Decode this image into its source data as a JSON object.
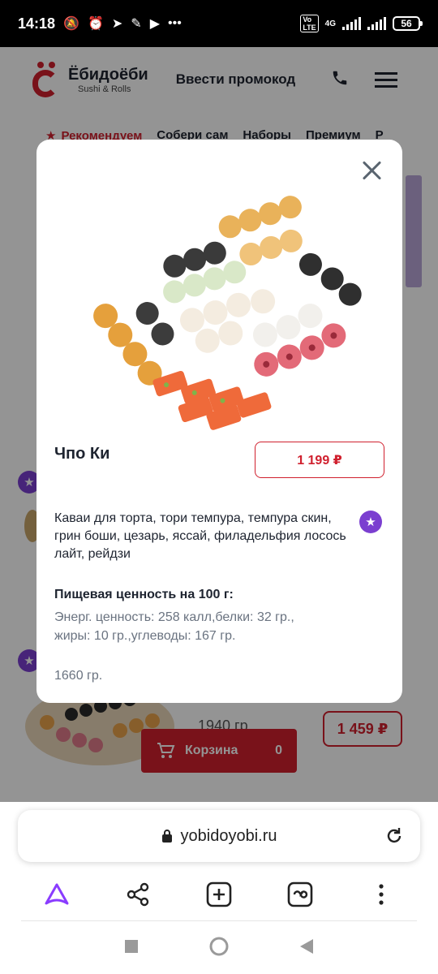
{
  "status_bar": {
    "time": "14:18",
    "network": "4G",
    "battery": "56"
  },
  "site": {
    "logo_title": "Ёбидоёби",
    "logo_sub": "Sushi & Rolls",
    "promo_label": "Ввести промокод",
    "categories": [
      "Рекомендуем",
      "Собери сам",
      "Наборы",
      "Премиум",
      "Р"
    ],
    "bg_weight": "1940 гр.",
    "bg_price": "1 459 ₽",
    "cart_label": "Корзина",
    "cart_count": "0"
  },
  "modal": {
    "product_name": "Чпо Ки",
    "price": "1 199 ₽",
    "description": "Каваи для торта, тори темпура, темпура скин, грин боши, цезарь, яссай, филадельфия лосось лайт, рейдзи",
    "nutrition_title": "Пищевая ценность на 100 г:",
    "nutrition_line1": "Энерг. ценность: 258 калл,белки: 32 гр.,",
    "nutrition_line2": "жиры: 10 гр.,углеводы: 167 гр.",
    "weight": "1660 гр."
  },
  "browser": {
    "url": "yobidoyobi.ru"
  },
  "icons": {
    "star": "★",
    "accent_red": "#d0202e",
    "badge_purple": "#7b3fd0"
  }
}
